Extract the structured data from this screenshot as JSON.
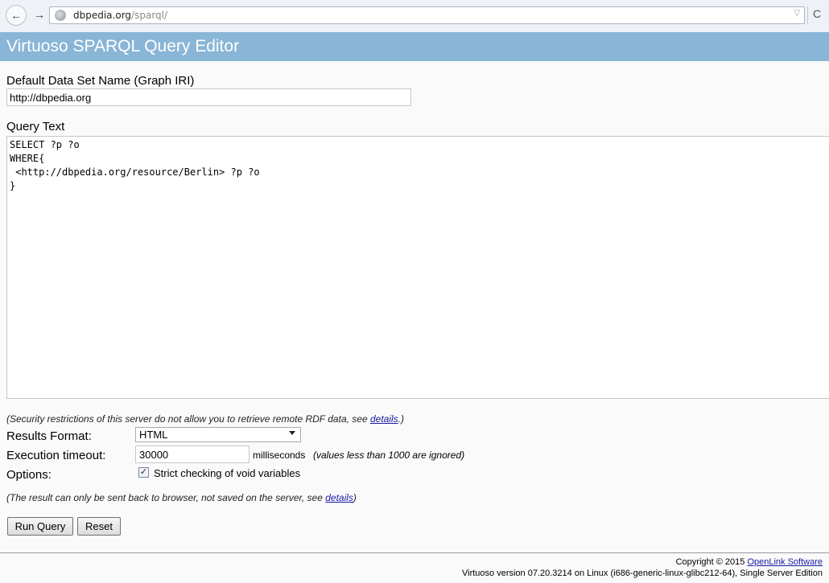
{
  "browser": {
    "url_host": "dbpedia.org",
    "url_path": "/sparql/"
  },
  "header": {
    "title": "Virtuoso SPARQL Query Editor"
  },
  "form": {
    "graph_label": "Default Data Set Name (Graph IRI)",
    "graph_value": "http://dbpedia.org",
    "query_label": "Query Text",
    "query_value": "SELECT ?p ?o\nWHERE{\n <http://dbpedia.org/resource/Berlin> ?p ?o\n}",
    "security_note_prefix": "(Security restrictions of this server do not allow you to retrieve remote RDF data, see ",
    "security_note_link": "details",
    "security_note_suffix": ".)",
    "results_format_label": "Results Format:",
    "results_format_value": "HTML",
    "timeout_label": "Execution timeout:",
    "timeout_value": "30000",
    "timeout_unit": "milliseconds",
    "timeout_hint": "(values less than 1000 are ignored)",
    "options_label": "Options:",
    "strict_label": "Strict checking of void variables",
    "strict_checked": true,
    "result_note_prefix": "(The result can only be sent back to browser, not saved on the server, see ",
    "result_note_link": "details",
    "result_note_suffix": ")",
    "run_button": "Run Query",
    "reset_button": "Reset"
  },
  "footer": {
    "copyright_prefix": "Copyright © 2015 ",
    "copyright_link": "OpenLink Software",
    "version": "Virtuoso version 07.20.3214 on Linux (i686-generic-linux-glibc212-64), Single Server Edition"
  },
  "colors": {
    "header_bg": "#89b5d6",
    "link": "#1a1aa6"
  }
}
